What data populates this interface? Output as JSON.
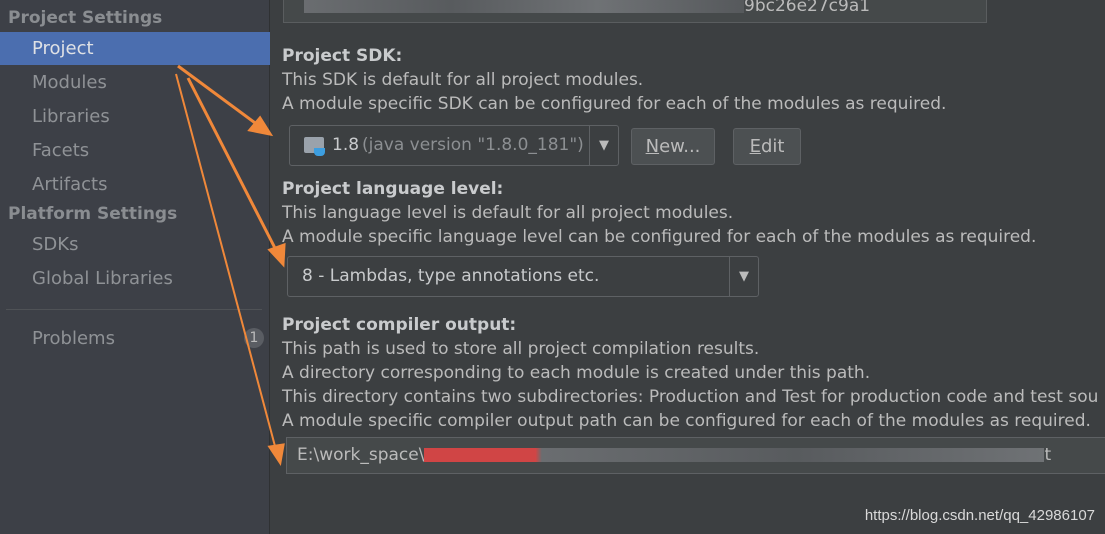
{
  "sidebar": {
    "project_settings": "Project Settings",
    "items": [
      "Project",
      "Modules",
      "Libraries",
      "Facets",
      "Artifacts"
    ],
    "platform_settings": "Platform Settings",
    "platform_items": [
      "SDKs",
      "Global Libraries"
    ],
    "problems": "Problems",
    "problems_count": "1"
  },
  "main": {
    "top_field_tail": "9bc26e27c9a1",
    "sdk": {
      "title": "Project SDK:",
      "line1": "This SDK is default for all project modules.",
      "line2": "A module specific SDK can be configured for each of the modules as required.",
      "version": "1.8",
      "detail": "(java version \"1.8.0_181\")",
      "new_mn": "N",
      "new_rest": "ew...",
      "edit_mn": "E",
      "edit_rest": "dit"
    },
    "lang": {
      "title": "Project language level:",
      "line1": "This language level is default for all project modules.",
      "line2": "A module specific language level can be configured for each of the modules as required.",
      "value": "8 - Lambdas, type annotations etc."
    },
    "output": {
      "title": "Project compiler output:",
      "line1": "This path is used to store all project compilation results.",
      "line2": "A directory corresponding to each module is created under this path.",
      "line3": "This directory contains two subdirectories: Production and Test for production code and test sou",
      "line4": "A module specific compiler output path can be configured for each of the modules as required.",
      "path_prefix": "E:\\work_space\\",
      "path_suffix": "t"
    }
  },
  "watermark": "https://blog.csdn.net/qq_42986107",
  "colors": {
    "selection": "#4b6eaf",
    "arrow": "#f0883a"
  }
}
